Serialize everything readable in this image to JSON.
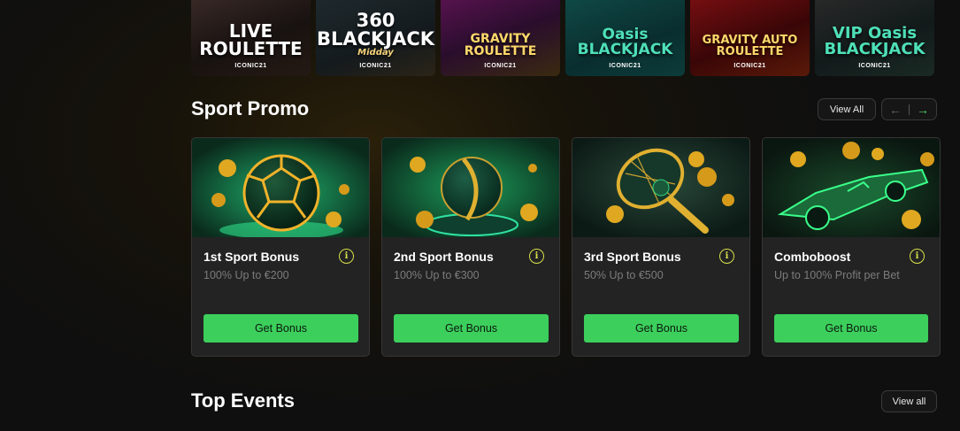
{
  "games": [
    {
      "title": "LIVE ROULETTE",
      "sub": "",
      "tag": "ICONIC21"
    },
    {
      "title": "360 BLACKJACK",
      "sub": "Midday",
      "tag": "ICONIC21"
    },
    {
      "title": "GRAVITY ROULETTE",
      "sub": "",
      "tag": "ICONIC21"
    },
    {
      "title": "Oasis BLACKJACK",
      "sub": "",
      "tag": "ICONIC21"
    },
    {
      "title": "GRAVITY AUTO ROULETTE",
      "sub": "",
      "tag": "ICONIC21"
    },
    {
      "title": "VIP Oasis BLACKJACK",
      "sub": "",
      "tag": "ICONIC21"
    }
  ],
  "sport_promo": {
    "title": "Sport Promo",
    "view_all": "View All",
    "prev_icon": "arrow-left-icon",
    "next_icon": "arrow-right-icon",
    "cards": [
      {
        "title": "1st Sport Bonus",
        "subtitle": "100% Up to €200",
        "button": "Get Bonus",
        "image": "soccer-ball-coins"
      },
      {
        "title": "2nd Sport Bonus",
        "subtitle": "100% Up to €300",
        "button": "Get Bonus",
        "image": "baseball-coins"
      },
      {
        "title": "3rd Sport Bonus",
        "subtitle": "50% Up to €500",
        "button": "Get Bonus",
        "image": "tennis-racket-coins"
      },
      {
        "title": "Comboboost",
        "subtitle": "Up to 100% Profit per Bet",
        "button": "Get Bonus",
        "image": "race-car-coins"
      }
    ]
  },
  "top_events": {
    "title": "Top Events",
    "view_all": "View all"
  },
  "colors": {
    "accent_green": "#3ccf5c",
    "info_icon": "#d7e04a",
    "card_bg": "#232323"
  }
}
